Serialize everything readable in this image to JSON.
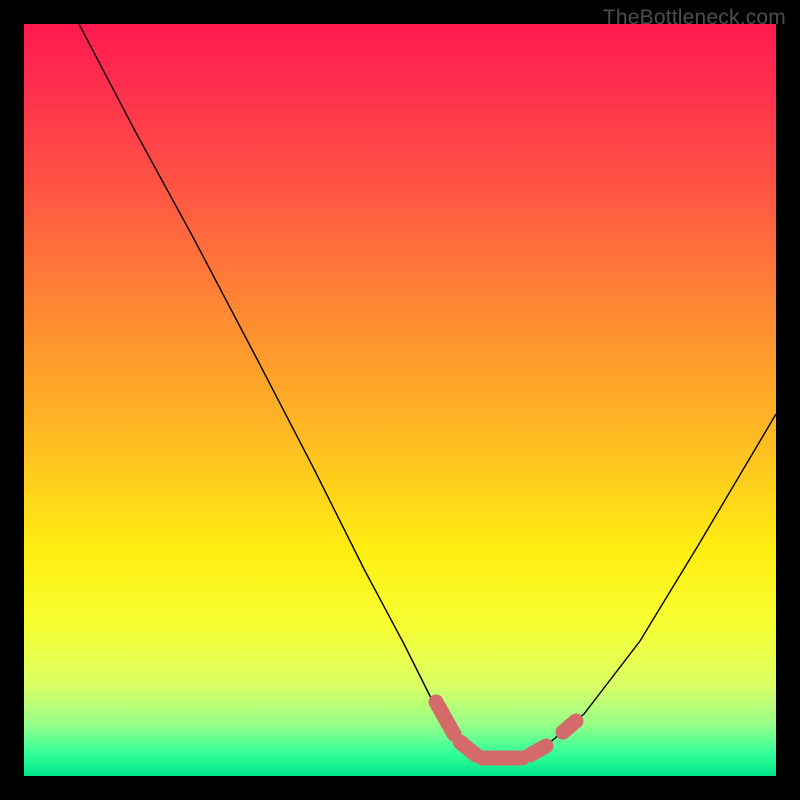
{
  "watermark": "TheBottleneck.com",
  "colors": {
    "background": "#000000",
    "curve": "#000000",
    "highlight": "#d46a6a",
    "gradient_top": "#ff1a4d",
    "gradient_bottom": "#00e68a"
  },
  "chart_data": {
    "type": "line",
    "title": "",
    "xlabel": "",
    "ylabel": "",
    "xlim": [
      0,
      100
    ],
    "ylim": [
      0,
      100
    ],
    "notes": "Background vertical gradient maps low values (green, bottom) to high values (red, top). Curve shows bottleneck percentage; highlighted segment near minimum indicates best-match range.",
    "series": [
      {
        "name": "bottleneck-curve",
        "x": [
          0,
          7,
          14,
          23,
          31,
          38,
          45,
          50,
          54,
          57,
          60,
          63,
          66,
          70,
          75,
          82,
          90,
          100
        ],
        "y": [
          100,
          88,
          76,
          61,
          47,
          35,
          23,
          14,
          8,
          4,
          2,
          2,
          3,
          5,
          10,
          20,
          33,
          52
        ]
      }
    ],
    "highlight_range": {
      "x_start": 54,
      "x_end": 70,
      "description": "near-zero bottleneck region"
    }
  }
}
